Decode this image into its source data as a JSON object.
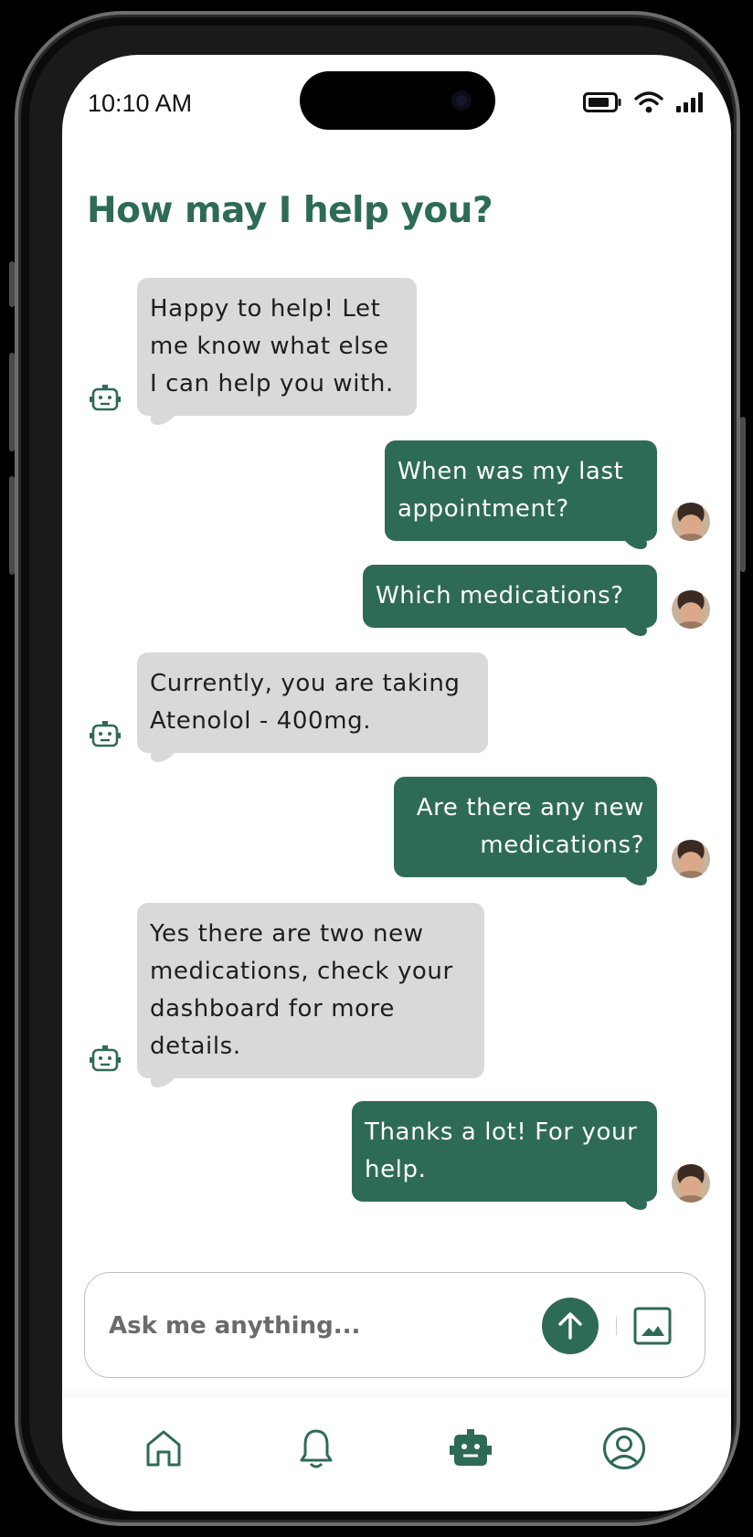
{
  "status_bar": {
    "time": "10:10 AM",
    "icons": [
      "battery-icon",
      "wifi-icon",
      "signal-icon"
    ]
  },
  "header": {
    "title": "How may I help you?"
  },
  "messages": [
    {
      "sender": "bot",
      "text": "Happy to help! Let me know what else I can help you with."
    },
    {
      "sender": "user",
      "text": "When was my last appointment?"
    },
    {
      "sender": "user",
      "text": "Which medications?"
    },
    {
      "sender": "bot",
      "text": "Currently, you are taking Atenolol - 400mg."
    },
    {
      "sender": "user",
      "text": "Are there any new medications?"
    },
    {
      "sender": "bot",
      "text": "Yes there are two new medications, check your dashboard for more details."
    },
    {
      "sender": "user",
      "text": "Thanks a lot! For your help."
    }
  ],
  "composer": {
    "placeholder": "Ask me anything...",
    "send_icon": "arrow-up-icon",
    "attach_icon": "image-icon"
  },
  "tab_bar": {
    "items": [
      {
        "icon": "home-icon",
        "active": false
      },
      {
        "icon": "bell-icon",
        "active": false
      },
      {
        "icon": "robot-icon",
        "active": true
      },
      {
        "icon": "profile-icon",
        "active": false
      }
    ]
  },
  "colors": {
    "accent": "#2e6b55",
    "bot_bubble": "#d9d9d9",
    "user_bubble": "#2e6b55"
  }
}
